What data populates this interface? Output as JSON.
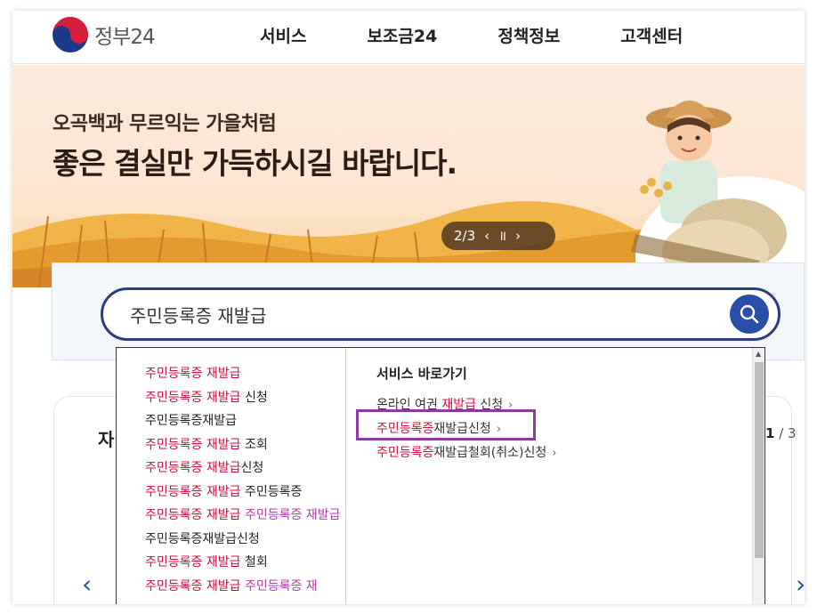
{
  "header": {
    "logo_text": "정부24",
    "nav": [
      "서비스",
      "보조금24",
      "정책정보",
      "고객센터"
    ]
  },
  "banner": {
    "subtitle": "오곡백과 무르익는 가을처럼",
    "title": "좋은 결실만 가득하시길 바랍니다.",
    "pager": {
      "current_total": "2/3",
      "prev": "‹",
      "pause": "॥",
      "next": "›"
    }
  },
  "search": {
    "value": "주민등록증 재발급",
    "button_icon": "search-icon"
  },
  "suggestions": [
    {
      "hl": "주민등록증 재발급",
      "rest": "",
      "hl2": ""
    },
    {
      "hl": "주민등록증 재발급",
      "rest": " 신청",
      "hl2": ""
    },
    {
      "hl": "",
      "rest": "주민등록증재발급",
      "hl2": ""
    },
    {
      "hl": "주민등록증 재발급",
      "rest": " 조회",
      "hl2": ""
    },
    {
      "hl": "주민등록증 재발급",
      "rest": "신청",
      "hl2": ""
    },
    {
      "hl": "주민등록증 재발급",
      "rest": " 주민등록증",
      "hl2": ""
    },
    {
      "hl": "주민등록증 재발급",
      "rest": " ",
      "hl2": "주민등록증 재발급"
    },
    {
      "hl": "",
      "rest": "주민등록증재발급신청",
      "hl2": ""
    },
    {
      "hl": "주민등록증 재발급",
      "rest": " 철회",
      "hl2": ""
    },
    {
      "hl": "주민등록증 재발급",
      "rest": " ",
      "hl2": "주민등록증 재"
    }
  ],
  "quick_links": {
    "title": "서비스 바로가기",
    "items": [
      {
        "pre": "온라인 여권 ",
        "hl": "재발급",
        "post": " 신청"
      },
      {
        "pre": "",
        "hl": "주민등록증",
        "post": "재발급신청"
      },
      {
        "pre": "",
        "hl": "주민등록증",
        "post": "재발급철회(취소)신청"
      }
    ]
  },
  "content": {
    "title_partial": "자",
    "page_current": "1",
    "page_total": "/ 3"
  },
  "colors": {
    "accent": "#2a4fa8",
    "highlight": "#d0103a",
    "highlight_alt": "#b53dad",
    "annotation": "#8e3ba1"
  }
}
